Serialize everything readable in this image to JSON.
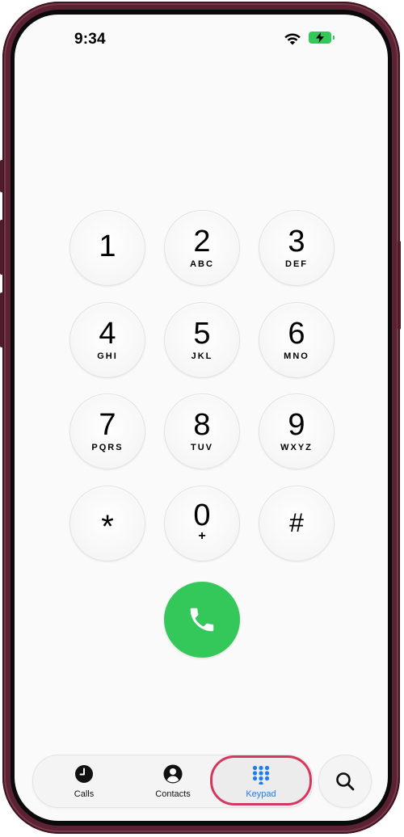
{
  "status_bar": {
    "time": "9:34"
  },
  "keypad": {
    "keys": [
      {
        "digit": "1",
        "letters": ""
      },
      {
        "digit": "2",
        "letters": "ABC"
      },
      {
        "digit": "3",
        "letters": "DEF"
      },
      {
        "digit": "4",
        "letters": "GHI"
      },
      {
        "digit": "5",
        "letters": "JKL"
      },
      {
        "digit": "6",
        "letters": "MNO"
      },
      {
        "digit": "7",
        "letters": "PQRS"
      },
      {
        "digit": "8",
        "letters": "TUV"
      },
      {
        "digit": "9",
        "letters": "WXYZ"
      },
      {
        "digit": "*",
        "letters": ""
      },
      {
        "digit": "0",
        "letters": "+"
      },
      {
        "digit": "#",
        "letters": ""
      }
    ]
  },
  "call_button": {
    "icon": "phone-icon",
    "color": "#34c759"
  },
  "tab_bar": {
    "tabs": [
      {
        "label": "Calls",
        "icon": "clock-icon"
      },
      {
        "label": "Contacts",
        "icon": "person-icon"
      },
      {
        "label": "Keypad",
        "icon": "keypad-grid-icon",
        "selected": true
      }
    ],
    "accent": "#1f7cf0",
    "highlight_border": "#d6375f"
  },
  "search": {
    "icon": "search-icon"
  }
}
